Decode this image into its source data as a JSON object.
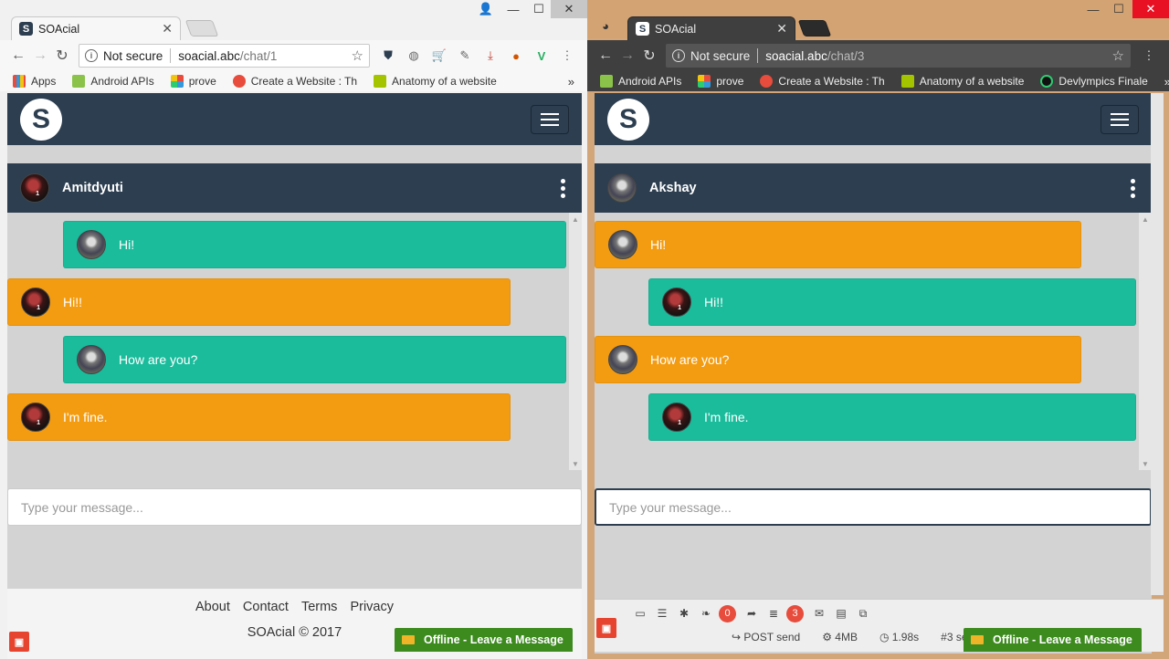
{
  "left_window": {
    "tab_title": "SOAcial",
    "url_security": "Not secure",
    "url_host": "soacial.abc",
    "url_path": "/chat/1",
    "bookmarks": [
      "Apps",
      "Android APIs",
      "prove",
      "Create a Website : Th",
      "Anatomy of a website"
    ],
    "chat_contact": "Amitdyuti",
    "messages": [
      {
        "text": "Hi!",
        "side": "right",
        "color": "teal"
      },
      {
        "text": "Hi!!",
        "side": "left",
        "color": "orange"
      },
      {
        "text": "How are you?",
        "side": "right",
        "color": "teal"
      },
      {
        "text": "I'm fine.",
        "side": "left",
        "color": "orange"
      }
    ],
    "input_placeholder": "Type your message...",
    "footer_links": [
      "About",
      "Contact",
      "Terms",
      "Privacy"
    ],
    "copyright": "SOAcial © 2017",
    "offline_widget": "Offline - Leave a Message"
  },
  "right_window": {
    "tab_title": "SOAcial",
    "url_security": "Not secure",
    "url_host": "soacial.abc",
    "url_path": "/chat/3",
    "bookmarks": [
      "Android APIs",
      "prove",
      "Create a Website : Th",
      "Anatomy of a website",
      "Devlympics Finale"
    ],
    "chat_contact": "Akshay",
    "messages": [
      {
        "text": "Hi!",
        "side": "left",
        "color": "orange"
      },
      {
        "text": "Hi!!",
        "side": "right",
        "color": "teal"
      },
      {
        "text": "How are you?",
        "side": "left",
        "color": "orange"
      },
      {
        "text": "I'm fine.",
        "side": "right",
        "color": "teal"
      }
    ],
    "input_placeholder": "Type your message...",
    "debugbar": {
      "badge_views": "0",
      "badge_queries": "3",
      "route": "POST send",
      "memory": "4MB",
      "time": "1.98s",
      "request": "#3 se"
    },
    "offline_widget": "Offline - Leave a Message"
  },
  "colors": {
    "navbar": "#2c3e50",
    "teal": "#1abc9c",
    "orange": "#f39c12",
    "offline_green": "#3d8b1f"
  }
}
